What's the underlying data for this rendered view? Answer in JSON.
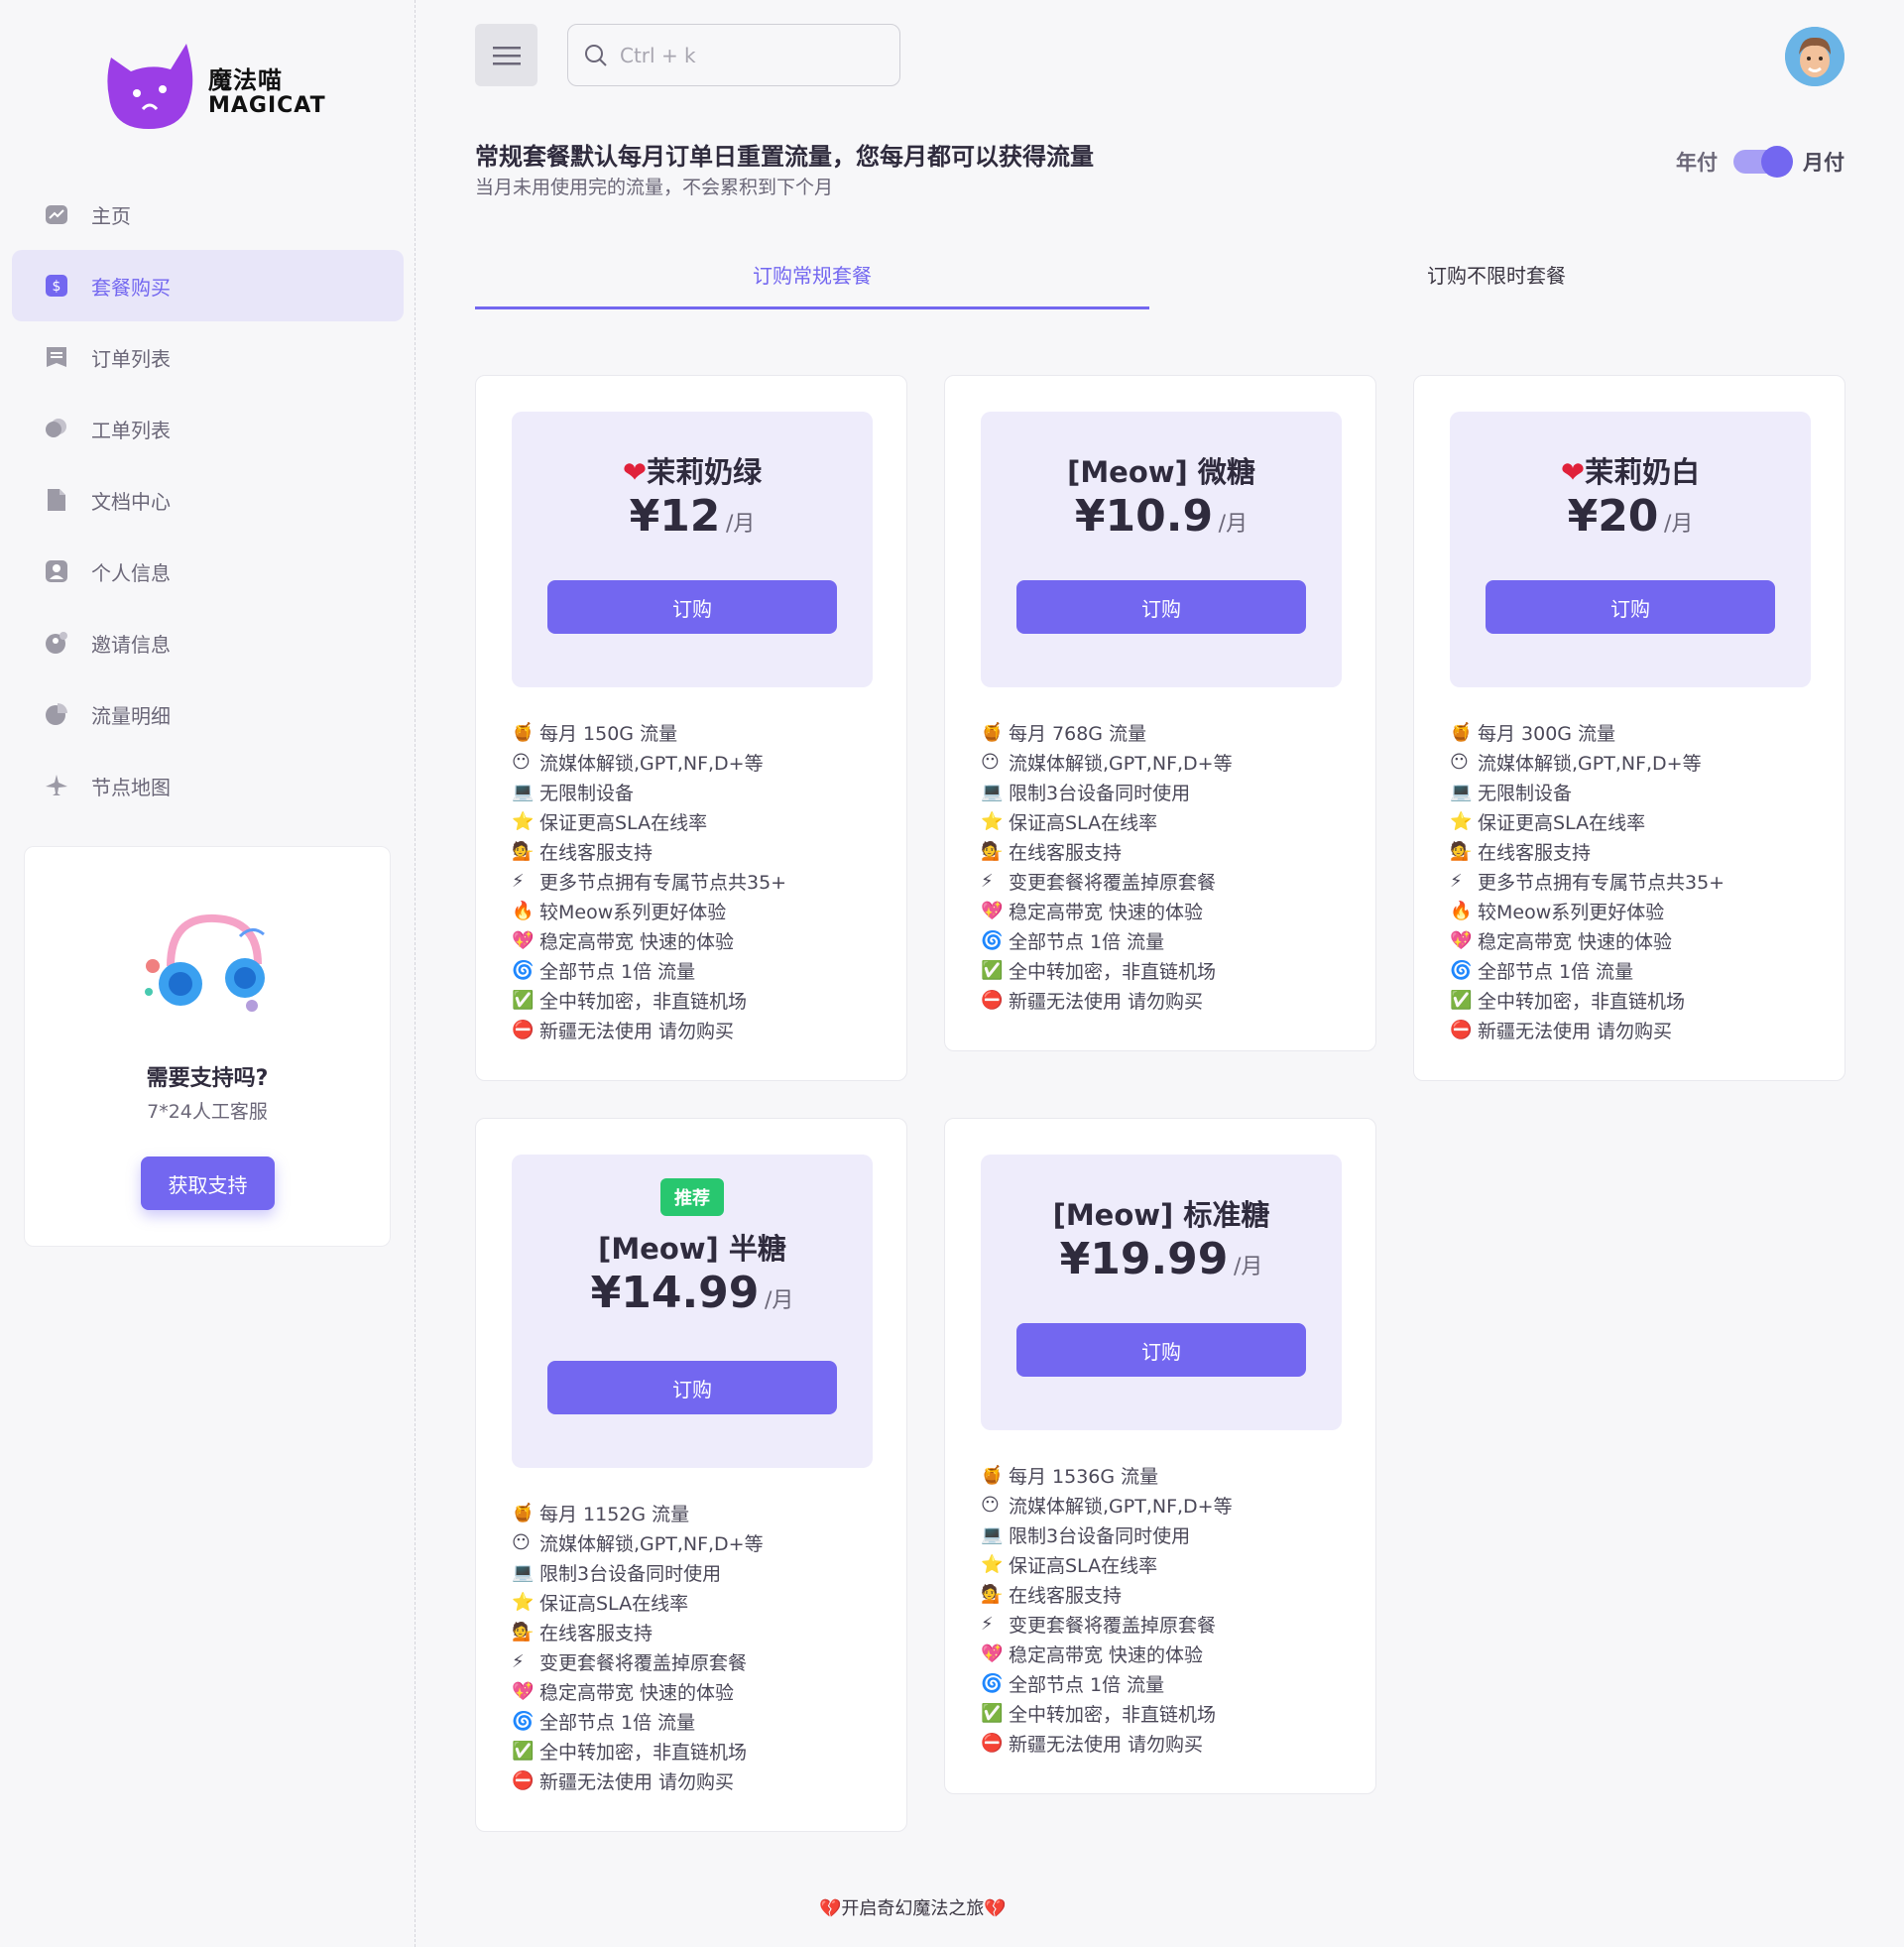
{
  "brand": {
    "cn": "魔法喵",
    "en": "MAGICAT"
  },
  "nav": [
    {
      "label": "主页",
      "icon": "chart-icon"
    },
    {
      "label": "套餐购买",
      "icon": "dollar-icon",
      "active": true
    },
    {
      "label": "订单列表",
      "icon": "receipt-icon"
    },
    {
      "label": "工单列表",
      "icon": "chat-icon"
    },
    {
      "label": "文档中心",
      "icon": "document-icon"
    },
    {
      "label": "个人信息",
      "icon": "user-icon"
    },
    {
      "label": "邀请信息",
      "icon": "invite-icon"
    },
    {
      "label": "流量明细",
      "icon": "pie-icon"
    },
    {
      "label": "节点地图",
      "icon": "plane-icon"
    }
  ],
  "support": {
    "title": "需要支持吗?",
    "subtitle": "7*24人工客服",
    "button": "获取支持"
  },
  "search": {
    "placeholder": "Ctrl + k"
  },
  "notice": {
    "title": "常规套餐默认每月订单日重置流量，您每月都可以获得流量",
    "subtitle": "当月未用使用完的流量，不会累积到下个月"
  },
  "billing_toggle": {
    "left": "年付",
    "right": "月付",
    "selected": "月付"
  },
  "tabs": [
    {
      "label": "订购常规套餐",
      "active": true
    },
    {
      "label": "订购不限时套餐",
      "active": false
    }
  ],
  "currency": "¥",
  "unit": "/月",
  "buy_label": "订购",
  "plans": [
    {
      "name": "茉莉奶绿",
      "name_icon": "heart-icon",
      "price": "12",
      "badge": "",
      "features": [
        {
          "icon": "🍯",
          "text": "每月 150G 流量"
        },
        {
          "icon": "😶",
          "text": "流媒体解锁,GPT,NF,D+等"
        },
        {
          "icon": "💻",
          "text": "无限制设备"
        },
        {
          "icon": "⭐",
          "text": "保证更高SLA在线率"
        },
        {
          "icon": "💁",
          "text": "在线客服支持"
        },
        {
          "icon": "⚡",
          "text": "更多节点拥有专属节点共35+"
        },
        {
          "icon": "🔥",
          "text": "较Meow系列更好体验"
        },
        {
          "icon": "💖",
          "text": "稳定高带宽 快速的体验"
        },
        {
          "icon": "🌀",
          "text": "全部节点 1倍 流量"
        },
        {
          "icon": "✅",
          "text": "全中转加密，非直链机场"
        },
        {
          "icon": "⛔",
          "text": "新疆无法使用 请勿购买"
        }
      ]
    },
    {
      "name": "[Meow] 微糖",
      "name_icon": "",
      "price": "10.9",
      "badge": "",
      "features": [
        {
          "icon": "🍯",
          "text": "每月 768G 流量"
        },
        {
          "icon": "😶",
          "text": "流媒体解锁,GPT,NF,D+等"
        },
        {
          "icon": "💻",
          "text": "限制3台设备同时使用"
        },
        {
          "icon": "⭐",
          "text": "保证高SLA在线率"
        },
        {
          "icon": "💁",
          "text": "在线客服支持"
        },
        {
          "icon": "⚡",
          "text": "变更套餐将覆盖掉原套餐"
        },
        {
          "icon": "💖",
          "text": "稳定高带宽 快速的体验"
        },
        {
          "icon": "🌀",
          "text": "全部节点 1倍 流量"
        },
        {
          "icon": "✅",
          "text": "全中转加密，非直链机场"
        },
        {
          "icon": "⛔",
          "text": "新疆无法使用 请勿购买"
        }
      ]
    },
    {
      "name": "茉莉奶白",
      "name_icon": "heart-icon",
      "price": "20",
      "badge": "",
      "features": [
        {
          "icon": "🍯",
          "text": "每月 300G 流量"
        },
        {
          "icon": "😶",
          "text": "流媒体解锁,GPT,NF,D+等"
        },
        {
          "icon": "💻",
          "text": "无限制设备"
        },
        {
          "icon": "⭐",
          "text": "保证更高SLA在线率"
        },
        {
          "icon": "💁",
          "text": "在线客服支持"
        },
        {
          "icon": "⚡",
          "text": "更多节点拥有专属节点共35+"
        },
        {
          "icon": "🔥",
          "text": "较Meow系列更好体验"
        },
        {
          "icon": "💖",
          "text": "稳定高带宽 快速的体验"
        },
        {
          "icon": "🌀",
          "text": "全部节点 1倍 流量"
        },
        {
          "icon": "✅",
          "text": "全中转加密，非直链机场"
        },
        {
          "icon": "⛔",
          "text": "新疆无法使用 请勿购买"
        }
      ]
    },
    {
      "name": "[Meow] 半糖",
      "name_icon": "",
      "price": "14.99",
      "badge": "推荐",
      "features": [
        {
          "icon": "🍯",
          "text": "每月 1152G 流量"
        },
        {
          "icon": "😶",
          "text": "流媒体解锁,GPT,NF,D+等"
        },
        {
          "icon": "💻",
          "text": "限制3台设备同时使用"
        },
        {
          "icon": "⭐",
          "text": "保证高SLA在线率"
        },
        {
          "icon": "💁",
          "text": "在线客服支持"
        },
        {
          "icon": "⚡",
          "text": "变更套餐将覆盖掉原套餐"
        },
        {
          "icon": "💖",
          "text": "稳定高带宽 快速的体验"
        },
        {
          "icon": "🌀",
          "text": "全部节点 1倍 流量"
        },
        {
          "icon": "✅",
          "text": "全中转加密，非直链机场"
        },
        {
          "icon": "⛔",
          "text": "新疆无法使用 请勿购买"
        }
      ]
    },
    {
      "name": "[Meow] 标准糖",
      "name_icon": "",
      "price": "19.99",
      "badge": "",
      "features": [
        {
          "icon": "🍯",
          "text": "每月 1536G 流量"
        },
        {
          "icon": "😶",
          "text": "流媒体解锁,GPT,NF,D+等"
        },
        {
          "icon": "💻",
          "text": "限制3台设备同时使用"
        },
        {
          "icon": "⭐",
          "text": "保证高SLA在线率"
        },
        {
          "icon": "💁",
          "text": "在线客服支持"
        },
        {
          "icon": "⚡",
          "text": "变更套餐将覆盖掉原套餐"
        },
        {
          "icon": "💖",
          "text": "稳定高带宽 快速的体验"
        },
        {
          "icon": "🌀",
          "text": "全部节点 1倍 流量"
        },
        {
          "icon": "✅",
          "text": "全中转加密，非直链机场"
        },
        {
          "icon": "⛔",
          "text": "新疆无法使用 请勿购买"
        }
      ]
    }
  ],
  "footer": {
    "text": "💔开启奇幻魔法之旅💔"
  },
  "colors": {
    "accent": "#7367f0",
    "accent_light": "#eeecfb",
    "badge": "#28c76f"
  }
}
